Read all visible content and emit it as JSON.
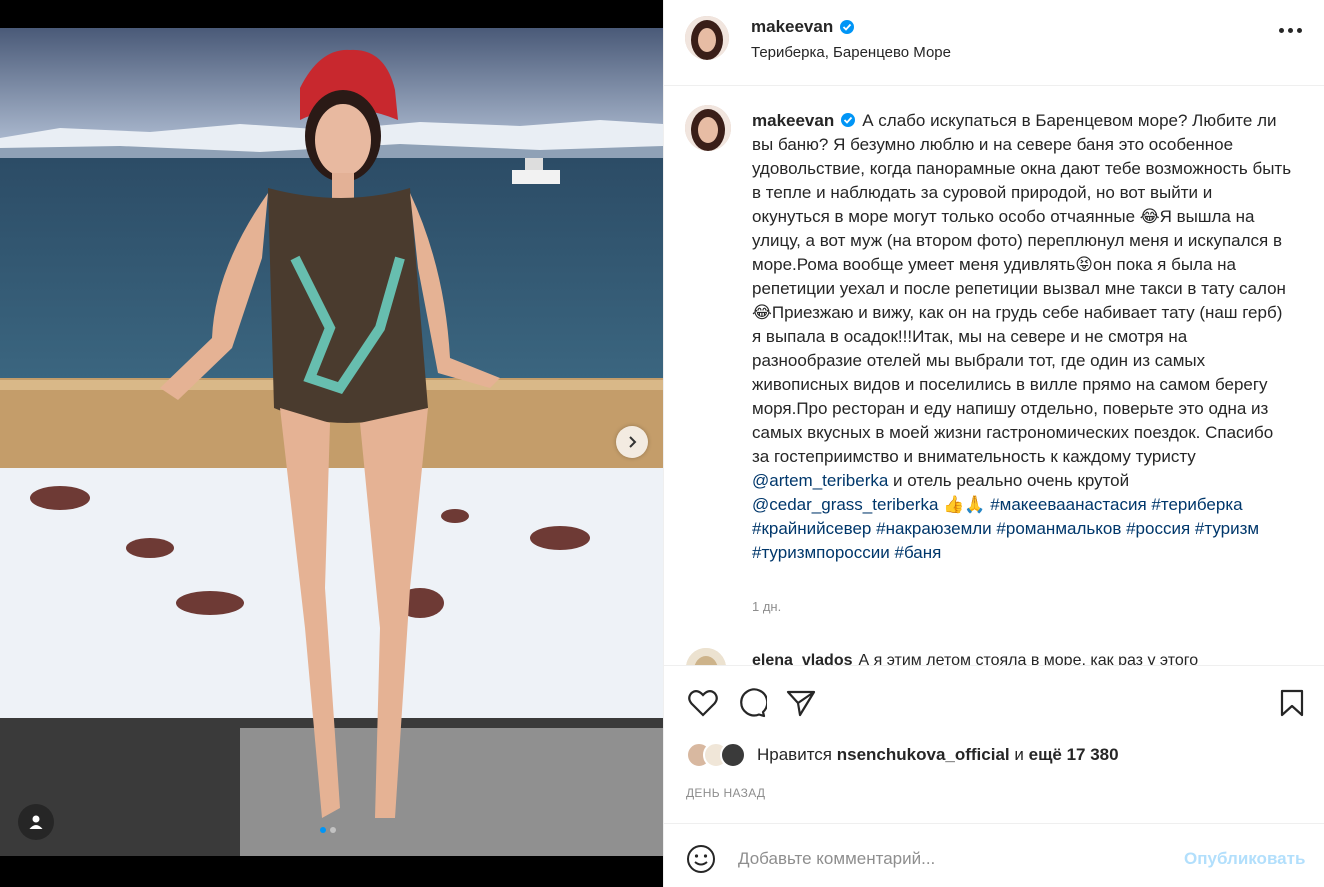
{
  "post": {
    "username": "makeevan",
    "location": "Териберка, Баренцево Море",
    "verified_icon": "verified-badge-icon"
  },
  "caption": {
    "username": "makeevan",
    "text_1": "А слабо искупаться в Баренцевом море? Любите ли вы баню? Я безумно люблю и на севере баня это особенное удовольствие, когда панорамные окна дают тебе возможность быть в тепле и наблюдать за суровой природой, но вот выйти и окунуться в море могут только особо отчаянные 😂Я вышла на улицу, а вот муж (на втором фото) переплюнул меня и искупался в море.Рома вообще умеет меня удивлять😝он пока я была на репетиции уехал и после репетиции вызвал мне такси в тату салон 😂Приезжаю и вижу, как он на грудь себе набивает тату (наш герб) я выпала в осадок!!!Итак, мы на севере и не смотря на разнообразие отелей мы выбрали тот, где один из самых живописных видов и поселились в вилле прямо на самом берегу моря.Про ресторан и еду напишу отдельно, поверьте это одна из самых вкусных в моей жизни гастрономических поездок. Спасибо за гостеприимство и внимательность к каждому туристу ",
    "mention_1": "@artem_teriberka",
    "text_2": " и отель реально очень крутой ",
    "mention_2": "@cedar_grass_teriberka",
    "text_3": " 👍🙏 ",
    "hashtags": [
      "#макееваанастасия",
      "#териберка",
      "#крайнийсевер",
      "#накраюземли",
      "#романмальков",
      "#россия",
      "#туризм",
      "#туризмпороссии",
      "#баня"
    ],
    "time": "1 дн."
  },
  "comment": {
    "username": "elena_vlados",
    "text": "А я этим летом стояла в море, как раз у этого"
  },
  "likes": {
    "prefix": "Нравится",
    "user": "nsenchukova_official",
    "middle": "и",
    "more": "ещё 17 380"
  },
  "date": "ДЕНЬ НАЗАД",
  "compose": {
    "placeholder": "Добавьте комментарий...",
    "post_label": "Опубликовать"
  },
  "colors": {
    "link": "#00376b",
    "post_disabled": "#b2dffc",
    "carousel_active": "#0095f6"
  }
}
